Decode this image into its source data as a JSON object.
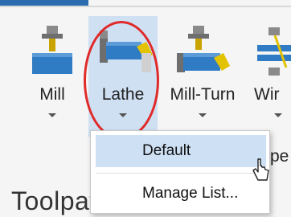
{
  "colors": {
    "accent": "#2b6cb0",
    "selected_bg": "#cfe0f3",
    "highlight_ring": "#e02a2a",
    "menu_hover": "#cde0f4"
  },
  "ribbon": {
    "buttons": [
      {
        "label": "Mill",
        "icon": "mill-icon"
      },
      {
        "label": "Lathe",
        "icon": "lathe-icon",
        "selected": true
      },
      {
        "label": "Mill-Turn",
        "icon": "mill-turn-icon"
      },
      {
        "label": "Wir",
        "icon": "wire-icon"
      }
    ],
    "partial_label": "pe"
  },
  "dropdown": {
    "items": [
      {
        "label": "Default",
        "highlighted": true
      },
      {
        "label": "Manage List..."
      }
    ]
  },
  "section": {
    "title": "Toolpaths"
  }
}
